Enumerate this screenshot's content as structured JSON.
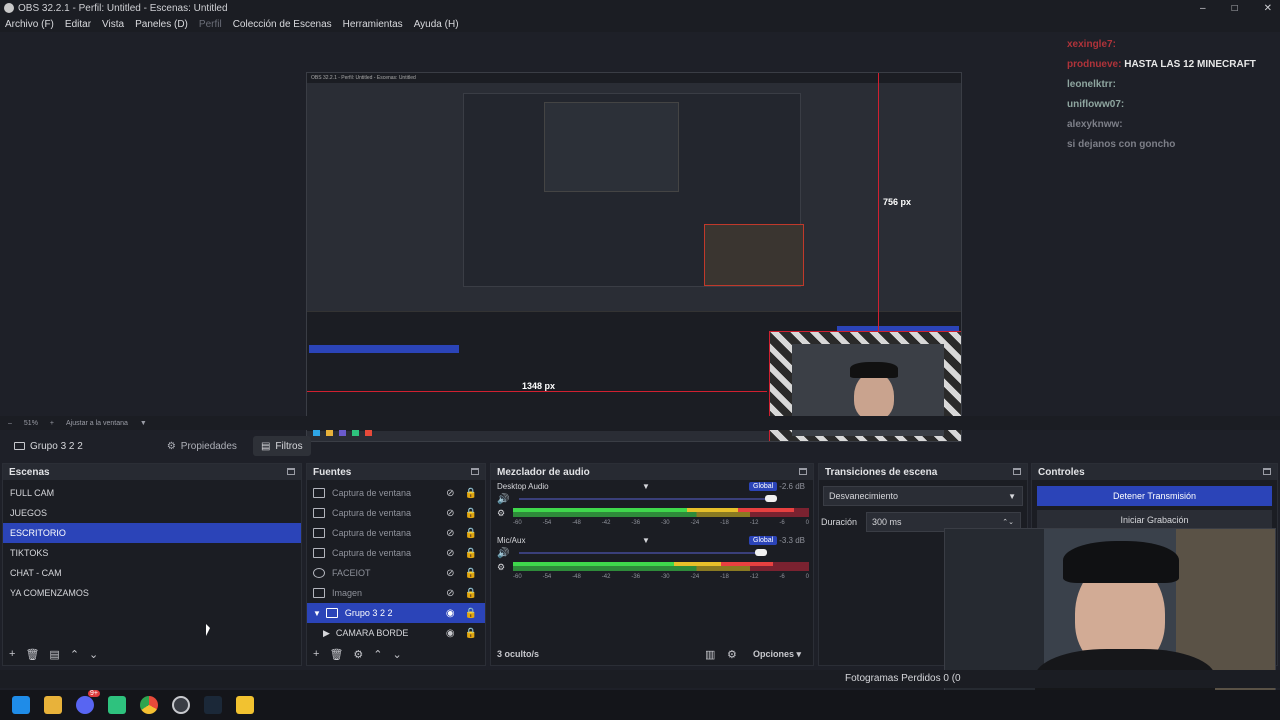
{
  "window": {
    "title": "OBS 32.2.1 - Perfil: Untitled - Escenas: Untitled",
    "controls": [
      "–",
      "□",
      "✕"
    ]
  },
  "menu": [
    {
      "label": "Archivo (F)",
      "enabled": true
    },
    {
      "label": "Editar",
      "enabled": true
    },
    {
      "label": "Vista",
      "enabled": true
    },
    {
      "label": "Paneles (D)",
      "enabled": true
    },
    {
      "label": "Perfil",
      "enabled": false
    },
    {
      "label": "Colección de Escenas",
      "enabled": true
    },
    {
      "label": "Herramientas",
      "enabled": true
    },
    {
      "label": "Ayuda (H)",
      "enabled": true
    }
  ],
  "preview": {
    "measure_vertical": "756 px",
    "measure_horizontal": "1348 px",
    "nested_title": "OBS 32.2.1 - Perfil: Untitled - Escenas: Untitled"
  },
  "chat": [
    {
      "user": "xexingle7:",
      "message": "",
      "color": "#b0333a"
    },
    {
      "user": "prodnueve:",
      "message": "HASTA LAS 12 MINECRAFT",
      "color": "#b0333a"
    },
    {
      "user": "leonelktrr:",
      "message": "",
      "color": "#8fa6a0"
    },
    {
      "user": "unifloww07:",
      "message": "",
      "color": "#8fa6a0"
    },
    {
      "user": "alexyknww:",
      "message": "",
      "color": "#7d7f88"
    },
    {
      "user": "",
      "message": "si dejanos con goncho",
      "color": "#7d7f88"
    }
  ],
  "zoombar": {
    "zoom": "51%",
    "fit_label": "Ajustar a la ventana"
  },
  "source_toolbar": {
    "group_name": "Grupo 3 2 2",
    "properties_label": "Propiedades",
    "filters_label": "Filtros"
  },
  "scenes": {
    "title": "Escenas",
    "items": [
      "FULL CAM",
      "JUEGOS",
      "ESCRITORIO",
      "TIKTOKS",
      "CHAT - CAM",
      "YA COMENZAMOS"
    ],
    "selected": "ESCRITORIO"
  },
  "sources": {
    "title": "Fuentes",
    "items": [
      {
        "label": "Captura de ventana",
        "icon": "window-icon"
      },
      {
        "label": "Captura de ventana",
        "icon": "window-icon"
      },
      {
        "label": "Captura de ventana",
        "icon": "window-icon"
      },
      {
        "label": "Captura de ventana",
        "icon": "window-icon"
      },
      {
        "label": "FACEIOT",
        "icon": "browser-icon"
      },
      {
        "label": "Imagen",
        "icon": "image-icon"
      },
      {
        "label": "Grupo 3 2 2",
        "icon": "folder-icon"
      },
      {
        "label": "CAMARA BORDE",
        "icon": "play-icon"
      }
    ],
    "selected": "Grupo 3 2 2"
  },
  "audio": {
    "title": "Mezclador de audio",
    "channels": [
      {
        "name": "Desktop Audio",
        "db": "-2.6 dB",
        "level": 0.9
      },
      {
        "name": "Mic/Aux",
        "db": "-3.3 dB",
        "level": 0.85
      }
    ],
    "global_label": "Global",
    "ticks": [
      "-60",
      "-54",
      "-48",
      "-42",
      "-36",
      "-30",
      "-24",
      "-18",
      "-12",
      "-6",
      "0"
    ],
    "hidden": "3 oculto/s",
    "options_label": "Opciones"
  },
  "transitions": {
    "title": "Transiciones de escena",
    "selected": "Desvanecimiento",
    "duration_label": "Duración",
    "duration_value": "300 ms"
  },
  "controls": {
    "title": "Controles",
    "stream_button": "Detener Transmisión",
    "record_button": "Iniciar Grabación"
  },
  "status": {
    "frames": "Fotogramas Perdidos 0 (0"
  },
  "taskbar": {
    "icons": [
      "windows-icon",
      "file-explorer-icon",
      "discord-icon",
      "green-app-icon",
      "chrome-icon",
      "obs-icon",
      "steam-icon",
      "sticky-icon"
    ],
    "badge": "9+"
  }
}
